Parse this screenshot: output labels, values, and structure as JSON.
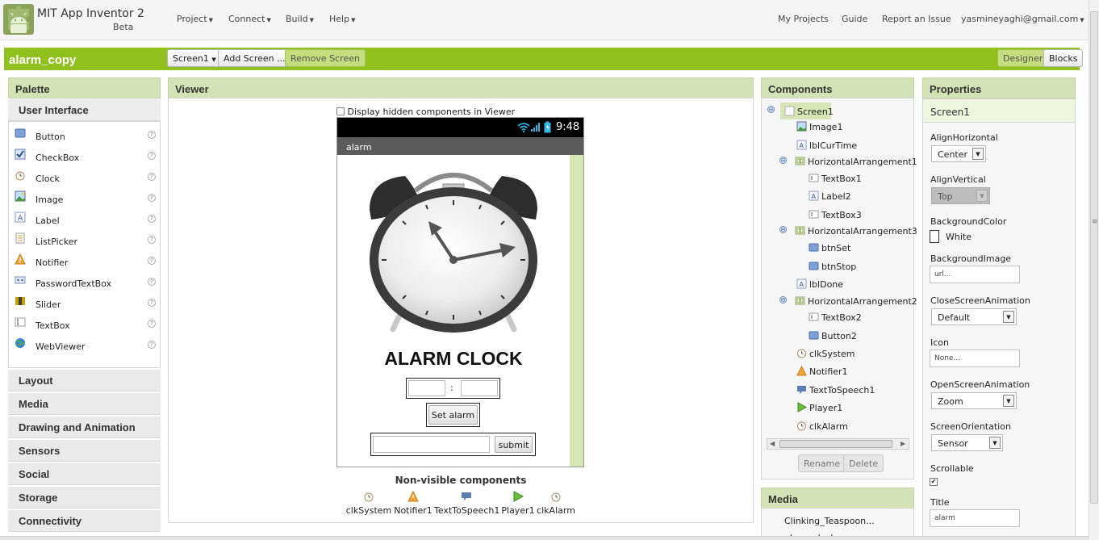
{
  "app": {
    "name": "MIT App Inventor 2",
    "badge": "Beta"
  },
  "top_menu": {
    "left": [
      "Project",
      "Connect",
      "Build",
      "Help"
    ],
    "right": [
      "My Projects",
      "Guide",
      "Report an Issue",
      "yasmineyaghi@gmail.com"
    ]
  },
  "project": {
    "name": "alarm_copy",
    "screen_select": "Screen1",
    "add_screen": "Add Screen ...",
    "remove_screen": "Remove Screen",
    "designer": "Designer",
    "blocks": "Blocks"
  },
  "palette": {
    "title": "Palette",
    "open_category": "User Interface",
    "items": [
      "Button",
      "CheckBox",
      "Clock",
      "Image",
      "Label",
      "ListPicker",
      "Notifier",
      "PasswordTextBox",
      "Slider",
      "TextBox",
      "WebViewer"
    ],
    "help": "?",
    "categories": [
      "Layout",
      "Media",
      "Drawing and Animation",
      "Sensors",
      "Social",
      "Storage",
      "Connectivity"
    ]
  },
  "viewer": {
    "title": "Viewer",
    "hidden_checkbox_label": "Display hidden components in Viewer",
    "status_time": "9:48",
    "screen_title": "alarm",
    "heading": "ALARM CLOCK",
    "time_separator": ":",
    "set_alarm": "Set alarm",
    "submit": "submit",
    "nonvisible_title": "Non-visible components",
    "nonvisible": [
      "clkSystem",
      "Notifier1",
      "TextToSpeech1",
      "Player1",
      "clkAlarm"
    ]
  },
  "components": {
    "title": "Components",
    "tree": [
      "Screen1",
      "Image1",
      "lblCurTime",
      "HorizontalArrangement1",
      "TextBox1",
      "Label2",
      "TextBox3",
      "HorizontalArrangement3",
      "btnSet",
      "btnStop",
      "lblDone",
      "HorizontalArrangement2",
      "TextBox2",
      "Button2",
      "clkSystem",
      "Notifier1",
      "TextToSpeech1",
      "Player1",
      "clkAlarm"
    ],
    "collapse": "⊖",
    "rename": "Rename",
    "delete": "Delete"
  },
  "media": {
    "title": "Media",
    "items": [
      "Clinking_Teaspoon...",
      "alarm-clock.png"
    ]
  },
  "properties": {
    "title": "Properties",
    "component": "Screen1",
    "align_horizontal_label": "AlignHorizontal",
    "align_horizontal": "Center",
    "align_vertical_label": "AlignVertical",
    "align_vertical": "Top",
    "background_color_label": "BackgroundColor",
    "background_color": "White",
    "background_image_label": "BackgroundImage",
    "background_image": "url...",
    "close_anim_label": "CloseScreenAnimation",
    "close_anim": "Default",
    "icon_label": "Icon",
    "icon": "None...",
    "open_anim_label": "OpenScreenAnimation",
    "open_anim": "Zoom",
    "orientation_label": "ScreenOrientation",
    "orientation": "Sensor",
    "scrollable_label": "Scrollable",
    "scrollable": true,
    "title_label": "Title",
    "title_value": "alarm"
  },
  "colors": {
    "accent": "#91c11e",
    "panel_header": "#d4e3b5"
  },
  "icons": {
    "logo": "app-inventor-android-logo",
    "help": "help-circle-icon"
  }
}
